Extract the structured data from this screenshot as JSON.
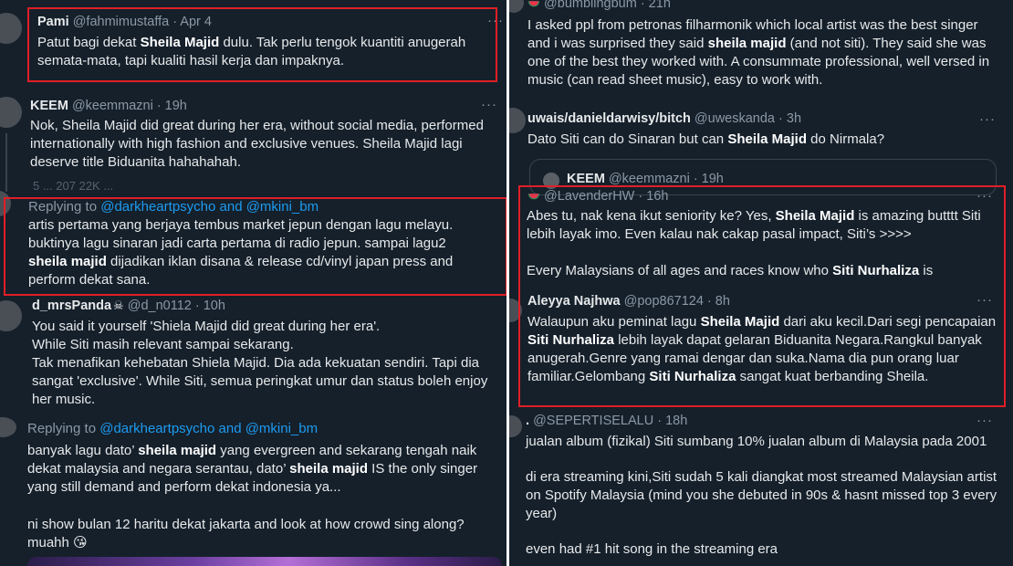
{
  "left": {
    "tweet1": {
      "name": "Pami",
      "meta": "@fahmimustaffa · Apr 4",
      "text1": "Patut bagi dekat ",
      "bold1": "Sheila Majid",
      "text2": " dulu. Tak perlu tengok kuantiti anugerah semata-mata, tapi kualiti hasil kerja dan impaknya."
    },
    "tweet2": {
      "name": "KEEM",
      "meta": "@keemmazni · 19h",
      "text": "Nok, Sheila Majid did great during her era, without social media, performed internationally with high fashion and exclusive venues. Sheila Majid lagi deserve title Biduanita hahahahah.",
      "actions": "5 ...              207               22K              ..."
    },
    "tweet3": {
      "replying_prefix": "Replying to ",
      "replying_handles": "@darkheartpsycho and @mkini_bm",
      "text1": "artis pertama yang berjaya tembus market jepun dengan lagu melayu. buktinya lagu sinaran jadi carta pertama di radio jepun. sampai lagu2 ",
      "bold1": "sheila majid",
      "text2": " dijadikan iklan disana & release cd/vinyl japan press and perform dekat sana."
    },
    "tweet4": {
      "name": "d_mrsPanda",
      "meta": "@d_n0112 · 10h",
      "text": "You said it yourself 'Shiela Majid did great during her era'.\nWhile Siti masih relevant sampai sekarang.\nTak menafikan kehebatan Shiela Majid. Dia ada kekuatan sendiri. Tapi dia sangat 'exclusive'. While Siti, semua peringkat umur dan status boleh enjoy her music."
    },
    "tweet5": {
      "replying_prefix": "Replying to ",
      "replying_handles": "@darkheartpsycho and @mkini_bm",
      "text1": "banyak lagu dato’ ",
      "bold1": "sheila majid",
      "text2": " yang evergreen and sekarang tengah naik dekat malaysia and negara serantau, dato’ ",
      "bold2": "sheila majid",
      "text3": " IS the only singer yang still demand and perform dekat indonesia ya...",
      "text4": "ni show bulan 12 haritu dekat jakarta and look at how crowd sing along? muahh 😘"
    }
  },
  "right": {
    "tweet1": {
      "meta": "@bumblingbum · 21h",
      "text1": "I asked ppl from petronas filharmonik which local artist was the best singer and i was surprised they said ",
      "bold1": "sheila majid",
      "text2": " (and not siti). They said she was one of the best they worked with. A consummate professional, well versed in music (can read sheet music), easy to work with."
    },
    "tweet2": {
      "name": "uwais/danieldarwisy/bitch",
      "meta": "@uweskanda · 3h",
      "text1": "Dato Siti can do Sinaran but can ",
      "bold1": "Sheila Majid",
      "text2": " do Nirmala?",
      "quote_name": "KEEM",
      "quote_meta": "@keemmazni · 19h"
    },
    "tweet3": {
      "meta": "@LavenderHW · 16h",
      "text1": "Abes tu, nak kena ikut seniority ke? Yes, ",
      "bold1": "Sheila Majid",
      "text2": " is amazing butttt Siti lebih layak imo. Even kalau nak cakap pasal impact, Siti’s >>>>",
      "text3": "Every Malaysians of all ages and races know who ",
      "bold2": "Siti Nurhaliza",
      "text4": " is"
    },
    "tweet4": {
      "name": "Aleyya Najhwa",
      "meta": "@pop867124 · 8h",
      "text1": "Walaupun aku peminat lagu ",
      "bold1": "Sheila Majid",
      "text2": " dari aku kecil.Dari segi pencapaian ",
      "bold2": "Siti Nurhaliza",
      "text3": " lebih layak dapat gelaran Biduanita Negara.Rangkul banyak anugerah.Genre yang ramai dengar dan suka.Nama dia pun orang luar familiar.Gelombang ",
      "bold3": "Siti Nurhaliza",
      "text4": " sangat kuat berbanding Sheila."
    },
    "tweet5": {
      "name": ".",
      "meta": "@SEPERTISELALU · 18h",
      "text1": "jualan album (fizikal) Siti sumbang 10% jualan album di Malaysia pada 2001",
      "text2": "di era streaming kini,Siti sudah 5 kali diangkat most streamed Malaysian artist on Spotify Malaysia (mind you she debuted in 90s & hasnt missed top 3 every year)",
      "text3": "even had #1 hit song in the streaming era"
    }
  },
  "more_label": "···",
  "colors": {
    "highlight_border": "#e01f26",
    "background": "#15202b",
    "link": "#1d9bf0"
  },
  "icons": [
    "watermelon-icon",
    "skull-crossbones-icon",
    "more-icon"
  ]
}
